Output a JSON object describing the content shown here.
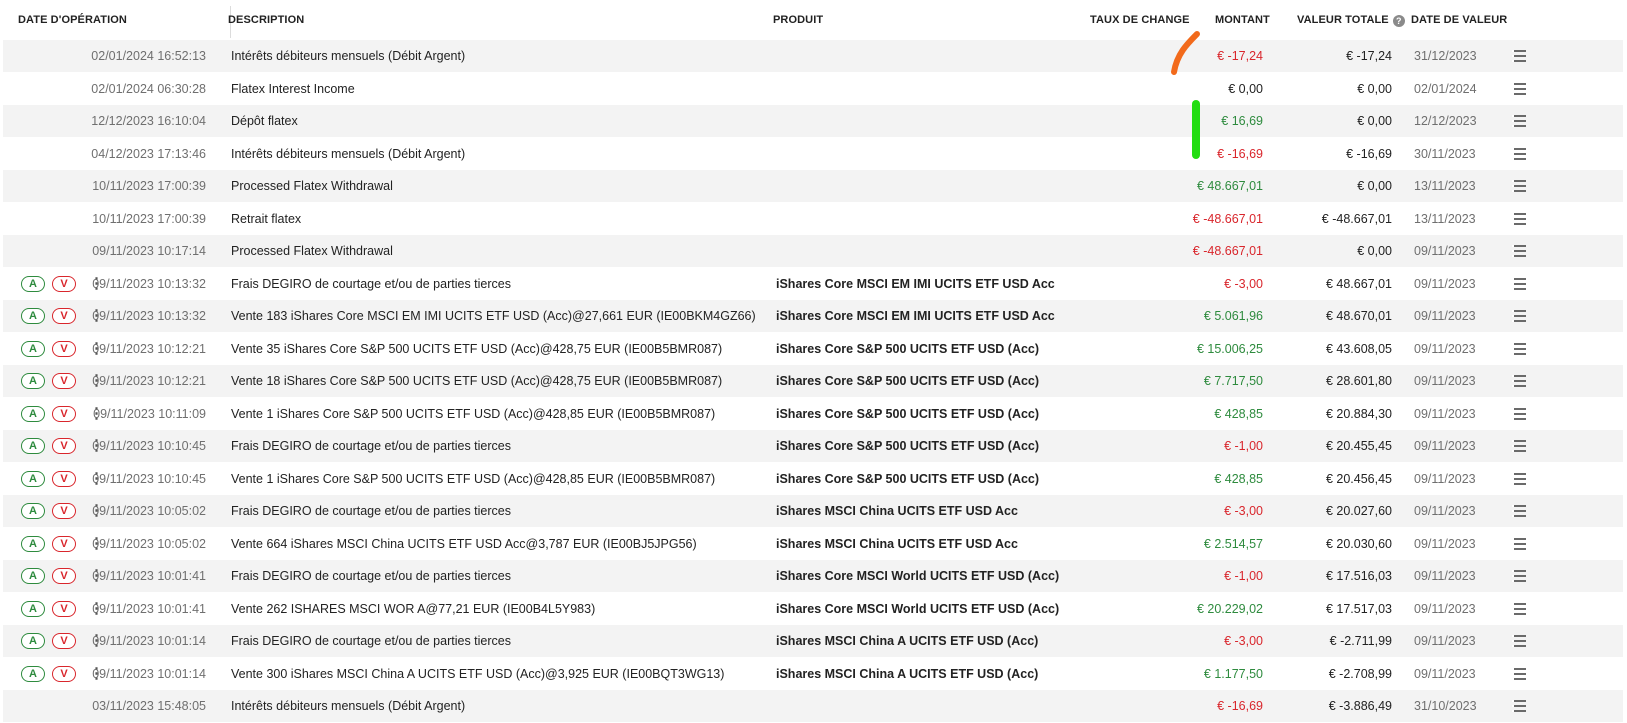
{
  "headers": {
    "date_operation": "DATE D'OPÉRATION",
    "description": "DESCRIPTION",
    "produit": "PRODUIT",
    "taux_de_change": "TAUX DE CHANGE",
    "montant": "MONTANT",
    "valeur_totale": "VALEUR TOTALE",
    "date_de_valeur": "DATE DE VALEUR"
  },
  "buttons": {
    "buy_label": "A",
    "sell_label": "V"
  },
  "icons": {
    "help": "help-circle-icon",
    "kebab": "more-vertical-icon",
    "menu": "list-menu-icon"
  },
  "colors": {
    "negative": "#d9262c",
    "positive": "#2e8b3e",
    "annotation_orange": "#f26a1b",
    "annotation_green": "#22dd11"
  },
  "rows": [
    {
      "actions": false,
      "date": "02/01/2024 16:52:13",
      "description": "Intérêts débiteurs mensuels (Débit Argent)",
      "produit": "",
      "montant": "€ -17,24",
      "sign": "neg",
      "total": "€ -17,24",
      "date_valeur": "31/12/2023"
    },
    {
      "actions": false,
      "date": "02/01/2024 06:30:28",
      "description": "Flatex Interest Income",
      "produit": "",
      "montant": "€ 0,00",
      "sign": "zero",
      "total": "€ 0,00",
      "date_valeur": "02/01/2024"
    },
    {
      "actions": false,
      "date": "12/12/2023 16:10:04",
      "description": "Dépôt flatex",
      "produit": "",
      "montant": "€ 16,69",
      "sign": "pos",
      "total": "€ 0,00",
      "date_valeur": "12/12/2023"
    },
    {
      "actions": false,
      "date": "04/12/2023 17:13:46",
      "description": "Intérêts débiteurs mensuels (Débit Argent)",
      "produit": "",
      "montant": "€ -16,69",
      "sign": "neg",
      "total": "€ -16,69",
      "date_valeur": "30/11/2023"
    },
    {
      "actions": false,
      "date": "10/11/2023 17:00:39",
      "description": "Processed Flatex Withdrawal",
      "produit": "",
      "montant": "€ 48.667,01",
      "sign": "pos",
      "total": "€ 0,00",
      "date_valeur": "13/11/2023"
    },
    {
      "actions": false,
      "date": "10/11/2023 17:00:39",
      "description": "Retrait flatex",
      "produit": "",
      "montant": "€ -48.667,01",
      "sign": "neg",
      "total": "€ -48.667,01",
      "date_valeur": "13/11/2023"
    },
    {
      "actions": false,
      "date": "09/11/2023 10:17:14",
      "description": "Processed Flatex Withdrawal",
      "produit": "",
      "montant": "€ -48.667,01",
      "sign": "neg",
      "total": "€ 0,00",
      "date_valeur": "09/11/2023"
    },
    {
      "actions": true,
      "date": "09/11/2023 10:13:32",
      "description": "Frais DEGIRO de courtage et/ou de parties tierces",
      "produit": "iShares Core MSCI EM IMI UCITS ETF USD Acc",
      "montant": "€ -3,00",
      "sign": "neg",
      "total": "€ 48.667,01",
      "date_valeur": "09/11/2023"
    },
    {
      "actions": true,
      "date": "09/11/2023 10:13:32",
      "description": "Vente 183 iShares Core MSCI EM IMI UCITS ETF USD (Acc)@27,661 EUR (IE00BKM4GZ66)",
      "produit": "iShares Core MSCI EM IMI UCITS ETF USD Acc",
      "montant": "€ 5.061,96",
      "sign": "pos",
      "total": "€ 48.670,01",
      "date_valeur": "09/11/2023"
    },
    {
      "actions": true,
      "date": "09/11/2023 10:12:21",
      "description": "Vente 35 iShares Core S&P 500 UCITS ETF USD (Acc)@428,75 EUR (IE00B5BMR087)",
      "produit": "iShares Core S&P 500 UCITS ETF USD (Acc)",
      "montant": "€ 15.006,25",
      "sign": "pos",
      "total": "€ 43.608,05",
      "date_valeur": "09/11/2023"
    },
    {
      "actions": true,
      "date": "09/11/2023 10:12:21",
      "description": "Vente 18 iShares Core S&P 500 UCITS ETF USD (Acc)@428,75 EUR (IE00B5BMR087)",
      "produit": "iShares Core S&P 500 UCITS ETF USD (Acc)",
      "montant": "€ 7.717,50",
      "sign": "pos",
      "total": "€ 28.601,80",
      "date_valeur": "09/11/2023"
    },
    {
      "actions": true,
      "date": "09/11/2023 10:11:09",
      "description": "Vente 1 iShares Core S&P 500 UCITS ETF USD (Acc)@428,85 EUR (IE00B5BMR087)",
      "produit": "iShares Core S&P 500 UCITS ETF USD (Acc)",
      "montant": "€ 428,85",
      "sign": "pos",
      "total": "€ 20.884,30",
      "date_valeur": "09/11/2023"
    },
    {
      "actions": true,
      "date": "09/11/2023 10:10:45",
      "description": "Frais DEGIRO de courtage et/ou de parties tierces",
      "produit": "iShares Core S&P 500 UCITS ETF USD (Acc)",
      "montant": "€ -1,00",
      "sign": "neg",
      "total": "€ 20.455,45",
      "date_valeur": "09/11/2023"
    },
    {
      "actions": true,
      "date": "09/11/2023 10:10:45",
      "description": "Vente 1 iShares Core S&P 500 UCITS ETF USD (Acc)@428,85 EUR (IE00B5BMR087)",
      "produit": "iShares Core S&P 500 UCITS ETF USD (Acc)",
      "montant": "€ 428,85",
      "sign": "pos",
      "total": "€ 20.456,45",
      "date_valeur": "09/11/2023"
    },
    {
      "actions": true,
      "date": "09/11/2023 10:05:02",
      "description": "Frais DEGIRO de courtage et/ou de parties tierces",
      "produit": "iShares MSCI China UCITS ETF USD Acc",
      "montant": "€ -3,00",
      "sign": "neg",
      "total": "€ 20.027,60",
      "date_valeur": "09/11/2023"
    },
    {
      "actions": true,
      "date": "09/11/2023 10:05:02",
      "description": "Vente 664 iShares MSCI China UCITS ETF USD Acc@3,787 EUR (IE00BJ5JPG56)",
      "produit": "iShares MSCI China UCITS ETF USD Acc",
      "montant": "€ 2.514,57",
      "sign": "pos",
      "total": "€ 20.030,60",
      "date_valeur": "09/11/2023"
    },
    {
      "actions": true,
      "date": "09/11/2023 10:01:41",
      "description": "Frais DEGIRO de courtage et/ou de parties tierces",
      "produit": "iShares Core MSCI World UCITS ETF USD (Acc)",
      "montant": "€ -1,00",
      "sign": "neg",
      "total": "€ 17.516,03",
      "date_valeur": "09/11/2023"
    },
    {
      "actions": true,
      "date": "09/11/2023 10:01:41",
      "description": "Vente 262 ISHARES MSCI WOR A@77,21 EUR (IE00B4L5Y983)",
      "produit": "iShares Core MSCI World UCITS ETF USD (Acc)",
      "montant": "€ 20.229,02",
      "sign": "pos",
      "total": "€ 17.517,03",
      "date_valeur": "09/11/2023"
    },
    {
      "actions": true,
      "date": "09/11/2023 10:01:14",
      "description": "Frais DEGIRO de courtage et/ou de parties tierces",
      "produit": "iShares MSCI China A UCITS ETF USD (Acc)",
      "montant": "€ -3,00",
      "sign": "neg",
      "total": "€ -2.711,99",
      "date_valeur": "09/11/2023"
    },
    {
      "actions": true,
      "date": "09/11/2023 10:01:14",
      "description": "Vente 300 iShares MSCI China A UCITS ETF USD (Acc)@3,925 EUR (IE00BQT3WG13)",
      "produit": "iShares MSCI China A UCITS ETF USD (Acc)",
      "montant": "€ 1.177,50",
      "sign": "pos",
      "total": "€ -2.708,99",
      "date_valeur": "09/11/2023"
    },
    {
      "actions": false,
      "date": "03/11/2023 15:48:05",
      "description": "Intérêts débiteurs mensuels (Débit Argent)",
      "produit": "",
      "montant": "€ -16,69",
      "sign": "neg",
      "total": "€ -3.886,49",
      "date_valeur": "31/10/2023"
    }
  ]
}
